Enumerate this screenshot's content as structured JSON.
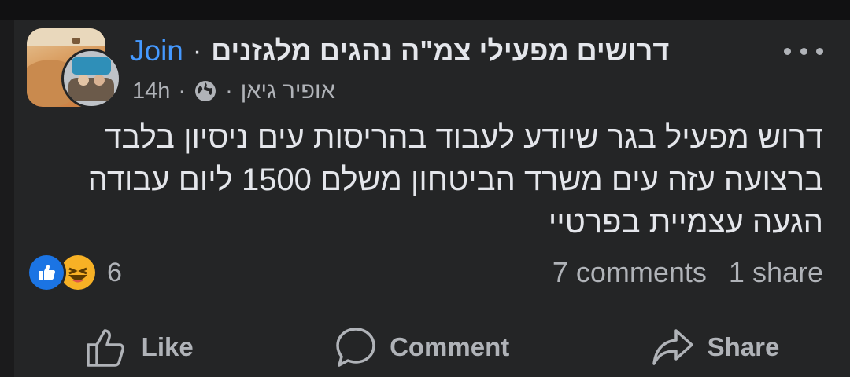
{
  "post": {
    "group_name": "דרושים מפעילי צמ\"ה נהגים מלגזנים",
    "join_label": "Join",
    "separator": "·",
    "author": "אופיר גיאן",
    "time": "14h",
    "privacy_icon": "globe-icon",
    "more_icon": "more-dots-icon",
    "body_lines": [
      "דרוש מפעיל בגר שיודע לעבוד בהריסות עים ניסיון בלבד",
      "ברצועה עזה עים משרד הביטחון משלם 1500 ליום עבודה",
      "הגעה עצמיית בפרטיי"
    ]
  },
  "engagement": {
    "reaction_count": "6",
    "comments": "7 comments",
    "shares": "1 share"
  },
  "actions": {
    "like_label": "Like",
    "comment_label": "Comment",
    "share_label": "Share"
  },
  "colors": {
    "background": "#242526",
    "join_link": "#4599ff",
    "like_reaction": "#1b74e4",
    "haha_reaction": "#f7b125",
    "secondary_text": "#b0b3b8"
  }
}
